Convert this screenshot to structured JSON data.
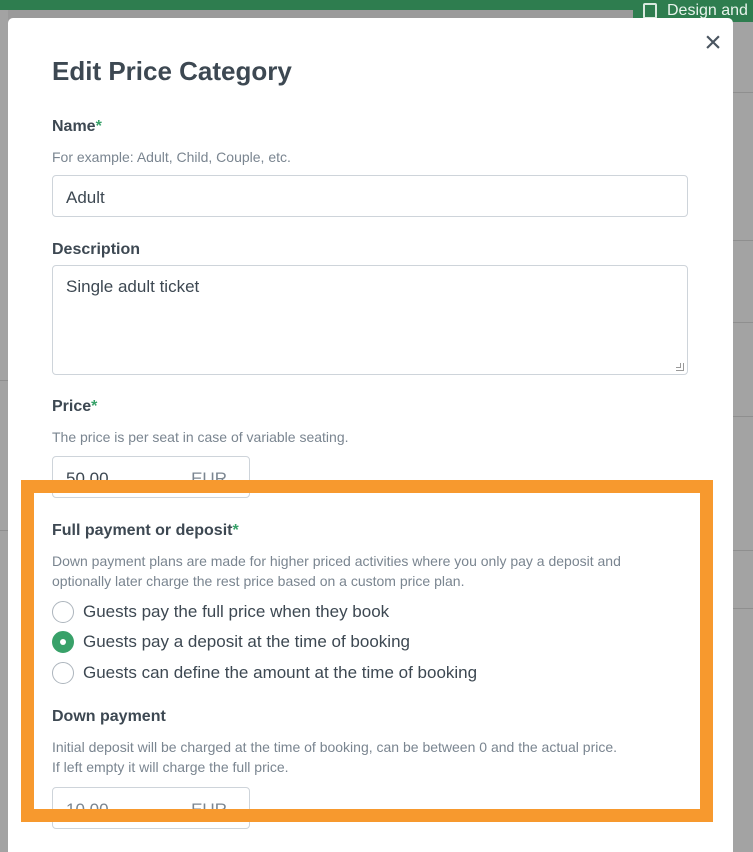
{
  "background": {
    "topbar_text": "Design and"
  },
  "modal": {
    "title": "Edit Price Category",
    "close_icon": "×",
    "name": {
      "label": "Name",
      "required_mark": "*",
      "help": "For example: Adult, Child, Couple, etc.",
      "value": "Adult"
    },
    "description": {
      "label": "Description",
      "value": "Single adult ticket"
    },
    "price": {
      "label": "Price",
      "required_mark": "*",
      "help": "The price is per seat in case of variable seating.",
      "value": "50,00",
      "currency": "EUR"
    },
    "payment": {
      "label": "Full payment or deposit",
      "required_mark": "*",
      "help_line1": "Down payment plans are made for higher priced activities where you only pay a deposit and",
      "help_line2": "optionally later charge the rest price based on a custom price plan.",
      "options": [
        {
          "label": "Guests pay the full price when they book",
          "selected": false
        },
        {
          "label": "Guests pay a deposit at the time of booking",
          "selected": true
        },
        {
          "label": "Guests can define the amount at the time of booking",
          "selected": false
        }
      ]
    },
    "down_payment": {
      "label": "Down payment",
      "help_line1": "Initial deposit will be charged at the time of booking, can be between 0 and the actual price.",
      "help_line2": "If left empty it will charge the full price.",
      "placeholder": "10.00",
      "currency": "EUR"
    }
  },
  "colors": {
    "accent": "#38a169",
    "highlight": "#f7992e",
    "header": "#2e7d4f"
  }
}
